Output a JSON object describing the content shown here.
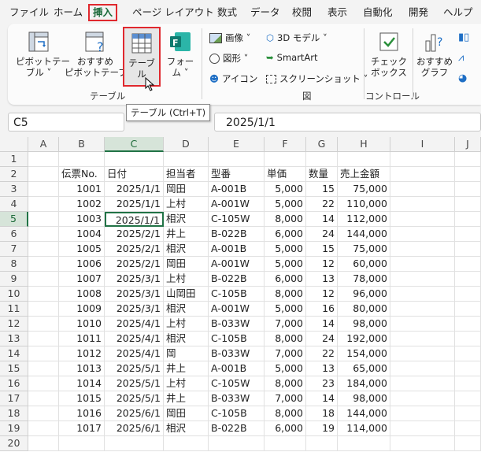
{
  "tabs": [
    "ファイル",
    "ホーム",
    "挿入",
    "ページ レイアウト",
    "数式",
    "データ",
    "校閲",
    "表示",
    "自動化",
    "開発",
    "ヘルプ"
  ],
  "active_tab": "挿入",
  "ribbon": {
    "pivot": "ピボットテー\nブル ˅",
    "rec_pivot": "おすすめ\nピボットテーブル",
    "table": "テーブル",
    "form": "フォー\nム ˅",
    "table_group": "テーブル",
    "image": "画像 ˅",
    "shape": "図形 ˅",
    "icon": "アイコン",
    "model3d": "3D モデル ˅",
    "smartart": "SmartArt",
    "screenshot": "スクリーンショット ˅",
    "fig_group": "図",
    "checkbox": "チェック\nボックス",
    "control_group": "コントロール",
    "rec_chart": "おすすめ\nグラフ",
    "tooltip": "テーブル (Ctrl+T)"
  },
  "formula": {
    "name_box": "C5",
    "value": "2025/1/1"
  },
  "columns": [
    "A",
    "B",
    "C",
    "D",
    "E",
    "F",
    "G",
    "H",
    "I",
    "J"
  ],
  "headers": [
    "伝票No.",
    "日付",
    "担当者",
    "型番",
    "単価",
    "数量",
    "売上金額"
  ],
  "rows": [
    [
      "1001",
      "2025/1/1",
      "岡田",
      "A-001B",
      "5,000",
      "15",
      "75,000"
    ],
    [
      "1002",
      "2025/1/1",
      "上村",
      "A-001W",
      "5,000",
      "22",
      "110,000"
    ],
    [
      "1003",
      "2025/1/1",
      "相沢",
      "C-105W",
      "8,000",
      "14",
      "112,000"
    ],
    [
      "1004",
      "2025/2/1",
      "井上",
      "B-022B",
      "6,000",
      "24",
      "144,000"
    ],
    [
      "1005",
      "2025/2/1",
      "相沢",
      "A-001B",
      "5,000",
      "15",
      "75,000"
    ],
    [
      "1006",
      "2025/2/1",
      "岡田",
      "A-001W",
      "5,000",
      "12",
      "60,000"
    ],
    [
      "1007",
      "2025/3/1",
      "上村",
      "B-022B",
      "6,000",
      "13",
      "78,000"
    ],
    [
      "1008",
      "2025/3/1",
      "山岡田",
      "C-105B",
      "8,000",
      "12",
      "96,000"
    ],
    [
      "1009",
      "2025/3/1",
      "相沢",
      "A-001W",
      "5,000",
      "16",
      "80,000"
    ],
    [
      "1010",
      "2025/4/1",
      "上村",
      "B-033W",
      "7,000",
      "14",
      "98,000"
    ],
    [
      "1011",
      "2025/4/1",
      "相沢",
      "C-105B",
      "8,000",
      "24",
      "192,000"
    ],
    [
      "1012",
      "2025/4/1",
      "岡",
      "B-033W",
      "7,000",
      "22",
      "154,000"
    ],
    [
      "1013",
      "2025/5/1",
      "井上",
      "A-001B",
      "5,000",
      "13",
      "65,000"
    ],
    [
      "1014",
      "2025/5/1",
      "上村",
      "C-105W",
      "8,000",
      "23",
      "184,000"
    ],
    [
      "1015",
      "2025/5/1",
      "井上",
      "B-033W",
      "7,000",
      "14",
      "98,000"
    ],
    [
      "1016",
      "2025/6/1",
      "岡田",
      "C-105B",
      "8,000",
      "18",
      "144,000"
    ],
    [
      "1017",
      "2025/6/1",
      "相沢",
      "B-022B",
      "6,000",
      "19",
      "114,000"
    ]
  ],
  "row_numbers": [
    "1",
    "2",
    "3",
    "4",
    "5",
    "6",
    "7",
    "8",
    "9",
    "10",
    "11",
    "12",
    "13",
    "14",
    "15",
    "16",
    "17",
    "18",
    "19",
    "20"
  ],
  "colors": {
    "accent": "#217346",
    "highlight": "#e0282e"
  }
}
